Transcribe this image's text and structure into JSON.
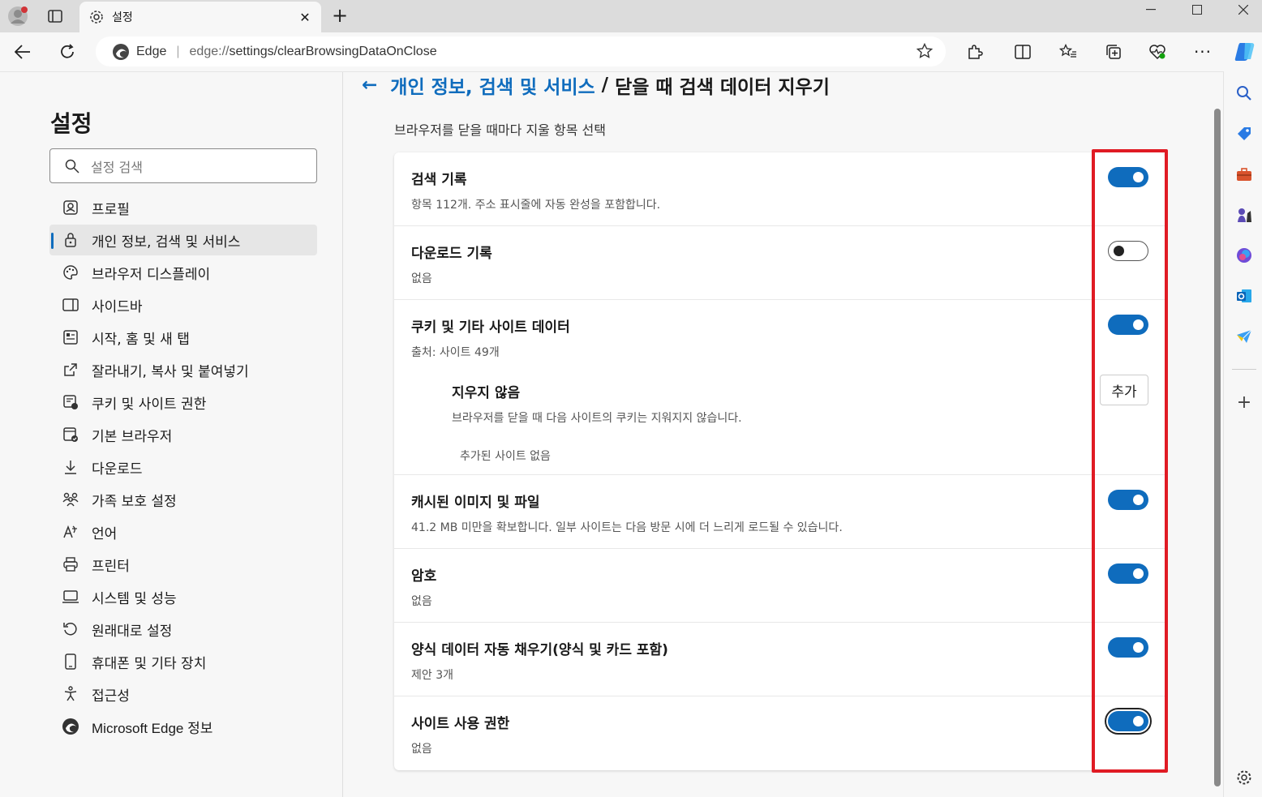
{
  "tab": {
    "title": "설정"
  },
  "address": {
    "site_label": "Edge",
    "url_scheme": "edge://",
    "url_path": "settings/clearBrowsingDataOnClose"
  },
  "nav": {
    "title": "설정",
    "search_placeholder": "설정 검색",
    "items": [
      {
        "label": "프로필",
        "icon": "profile-icon"
      },
      {
        "label": "개인 정보, 검색 및 서비스",
        "icon": "lock-icon",
        "active": true
      },
      {
        "label": "브라우저 디스플레이",
        "icon": "palette-icon"
      },
      {
        "label": "사이드바",
        "icon": "sidebar-icon"
      },
      {
        "label": "시작, 홈 및 새 탭",
        "icon": "home-icon"
      },
      {
        "label": "잘라내기, 복사 및 붙여넣기",
        "icon": "share-icon"
      },
      {
        "label": "쿠키 및 사이트 권한",
        "icon": "site-permissions-icon"
      },
      {
        "label": "기본 브라우저",
        "icon": "default-browser-icon"
      },
      {
        "label": "다운로드",
        "icon": "download-icon"
      },
      {
        "label": "가족 보호 설정",
        "icon": "family-icon"
      },
      {
        "label": "언어",
        "icon": "language-icon"
      },
      {
        "label": "프린터",
        "icon": "printer-icon"
      },
      {
        "label": "시스템 및 성능",
        "icon": "laptop-icon"
      },
      {
        "label": "원래대로 설정",
        "icon": "reset-icon"
      },
      {
        "label": "휴대폰 및 기타 장치",
        "icon": "phone-icon"
      },
      {
        "label": "접근성",
        "icon": "accessibility-icon"
      },
      {
        "label": "Microsoft Edge 정보",
        "icon": "edge-logo-icon"
      }
    ]
  },
  "main": {
    "breadcrumb_parent": "개인 정보, 검색 및 서비스",
    "breadcrumb_sep": "/",
    "breadcrumb_current": "닫을 때 검색 데이터 지우기",
    "subtitle": "브라우저를 닫을 때마다 지울 항목 선택",
    "rows": [
      {
        "title": "검색 기록",
        "desc": "항목 112개. 주소 표시줄에 자동 완성을 포함합니다.",
        "on": true
      },
      {
        "title": "다운로드 기록",
        "desc": "없음",
        "on": false
      },
      {
        "title": "쿠키 및 기타 사이트 데이터",
        "desc": "출처: 사이트 49개",
        "on": true
      },
      {
        "title": "캐시된 이미지 및 파일",
        "desc": "41.2 MB 미만을 확보합니다. 일부 사이트는 다음 방문 시에 더 느리게 로드될 수 있습니다.",
        "on": true
      },
      {
        "title": "암호",
        "desc": "없음",
        "on": true
      },
      {
        "title": "양식 데이터 자동 채우기(양식 및 카드 포함)",
        "desc": "제안 3개",
        "on": true
      },
      {
        "title": "사이트 사용 권한",
        "desc": "없음",
        "on": true
      }
    ],
    "cookie_exceptions": {
      "title": "지우지 않음",
      "desc": "브라우저를 닫을 때 다음 사이트의 쿠키는 지워지지 않습니다.",
      "add_label": "추가",
      "empty_text": "추가된 사이트 없음"
    }
  },
  "colors": {
    "accent": "#0f6cbd",
    "highlight": "#e01b24"
  }
}
